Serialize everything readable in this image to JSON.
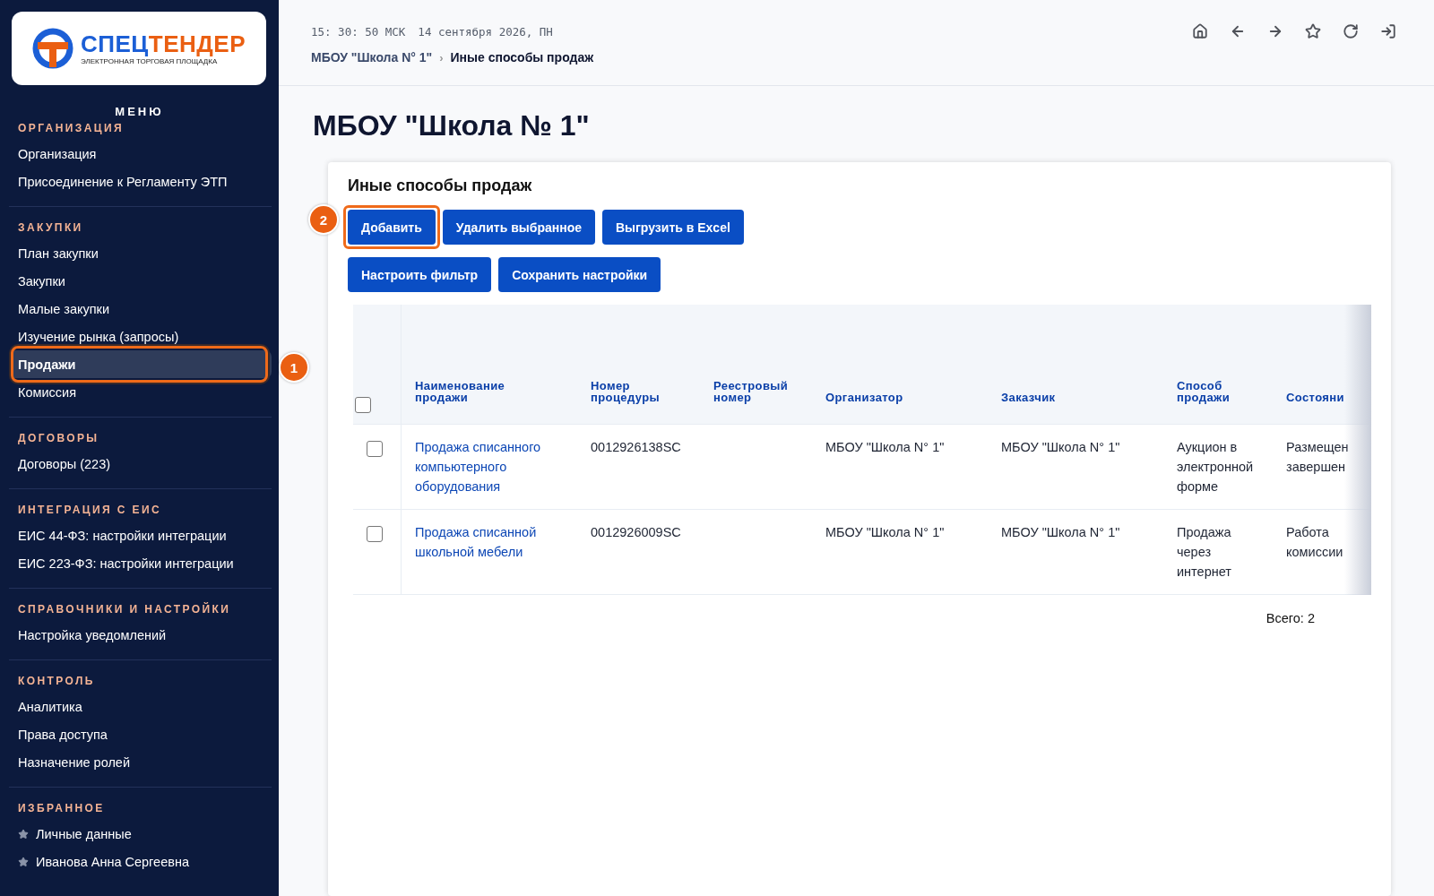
{
  "logo": {
    "part_1": "СПЕЦ",
    "part_2": "ТЕНДЕР",
    "subtitle": "ЭЛЕКТРОННАЯ ТОРГОВАЯ ПЛОЩАДКА"
  },
  "sidebar": {
    "title": "МЕНЮ",
    "sections": [
      {
        "heading": "ОРГАНИЗАЦИЯ",
        "items": [
          {
            "label": "Организация",
            "selected": false
          },
          {
            "label": "Присоединение к Регламенту ЭТП",
            "selected": false
          }
        ]
      },
      {
        "heading": "ЗАКУПКИ",
        "items": [
          {
            "label": "План закупки",
            "selected": false
          },
          {
            "label": "Закупки",
            "selected": false
          },
          {
            "label": "Малые закупки",
            "selected": false
          },
          {
            "label": "Изучение рынка (запросы)",
            "selected": false
          },
          {
            "label": "Продажи",
            "selected": true,
            "marker": "1"
          },
          {
            "label": "Комиссия",
            "selected": false
          }
        ]
      },
      {
        "heading": "ДОГОВОРЫ",
        "items": [
          {
            "label": "Договоры (223)",
            "selected": false
          }
        ]
      },
      {
        "heading": "ИНТЕГРАЦИЯ С ЕИС",
        "items": [
          {
            "label": "ЕИС 44-ФЗ: настройки интеграции",
            "selected": false
          },
          {
            "label": "ЕИС 223-ФЗ: настройки интеграции",
            "selected": false
          }
        ]
      },
      {
        "heading": "СПРАВОЧНИКИ И НАСТРОЙКИ",
        "items": [
          {
            "label": "Настройка уведомлений",
            "selected": false
          }
        ]
      },
      {
        "heading": "КОНТРОЛЬ",
        "items": [
          {
            "label": "Аналитика",
            "selected": false
          },
          {
            "label": "Права доступа",
            "selected": false
          },
          {
            "label": "Назначение ролей",
            "selected": false
          }
        ]
      },
      {
        "heading": "ИЗБРАННОЕ",
        "items": [
          {
            "label": "Личные данные",
            "selected": false,
            "starred": true
          },
          {
            "label": "Иванова Анна Сергеевна",
            "selected": false,
            "starred": true
          }
        ]
      }
    ]
  },
  "topbar": {
    "clock": "15: 30: 50 МСК",
    "date": "14 сентября 2026, ПН",
    "breadcrumb": [
      {
        "label": "МБОУ \"Школа N° 1\""
      },
      {
        "label": "Иные способы продаж"
      }
    ],
    "separator": "›"
  },
  "page_title": "МБОУ \"Школа № 1\"",
  "card": {
    "title": "Иные способы продаж",
    "buttons": [
      [
        {
          "label": "Добавить",
          "marker": "2"
        },
        {
          "label": "Удалить выбранное"
        },
        {
          "label": "Выгрузить в Excel"
        }
      ],
      [
        {
          "label": "Настроить фильтр"
        },
        {
          "label": "Сохранить настройки"
        }
      ]
    ],
    "table": {
      "select_all_checked": false,
      "columns": [
        "Наименование продажи",
        "Номер процедуры",
        "Реестровый номер",
        "Организатор",
        "Заказчик",
        "Способ продажи",
        "Состояни"
      ],
      "rows": [
        {
          "checked": false,
          "cells": [
            "Продажа списанного компьютерного оборудования",
            "0012926138SC",
            "",
            "МБОУ \"Школа N° 1\"",
            "МБОУ \"Школа N° 1\"",
            "Аукцион в электронной форме",
            "Размещен завершен"
          ]
        },
        {
          "checked": false,
          "cells": [
            "Продажа списанной школьной мебели",
            "0012926009SC",
            "",
            "МБОУ \"Школа N° 1\"",
            "МБОУ \"Школа N° 1\"",
            "Продажа через интернет",
            "Работа комиссии"
          ]
        }
      ]
    },
    "total": "Всего: 2"
  }
}
